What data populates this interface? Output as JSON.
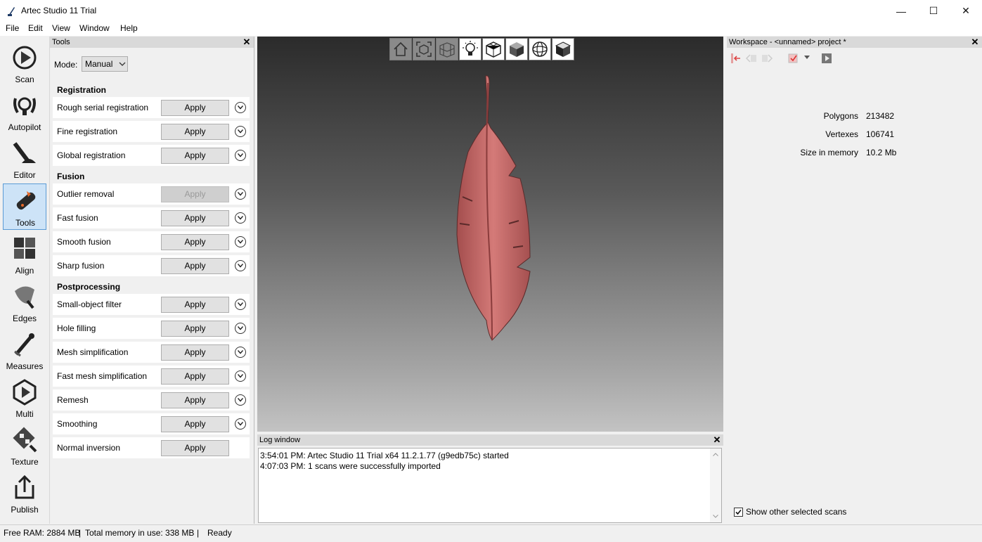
{
  "window": {
    "title": "Artec Studio 11 Trial"
  },
  "menu": [
    "File",
    "Edit",
    "View",
    "Window",
    "Help"
  ],
  "sidebar": [
    {
      "label": "Scan",
      "icon": "scan-icon"
    },
    {
      "label": "Autopilot",
      "icon": "autopilot-icon"
    },
    {
      "label": "Editor",
      "icon": "editor-icon"
    },
    {
      "label": "Tools",
      "icon": "tools-icon",
      "active": true
    },
    {
      "label": "Align",
      "icon": "align-icon"
    },
    {
      "label": "Edges",
      "icon": "edges-icon"
    },
    {
      "label": "Measures",
      "icon": "measures-icon"
    },
    {
      "label": "Multi",
      "icon": "multi-icon"
    },
    {
      "label": "Texture",
      "icon": "texture-icon"
    },
    {
      "label": "Publish",
      "icon": "publish-icon"
    }
  ],
  "tools": {
    "header": "Tools",
    "mode_label": "Mode:",
    "mode_value": "Manual",
    "apply_label": "Apply",
    "sections": [
      {
        "title": "Registration",
        "items": [
          "Rough serial registration",
          "Fine registration",
          "Global registration"
        ]
      },
      {
        "title": "Fusion",
        "items": [
          "Outlier removal",
          "Fast fusion",
          "Smooth fusion",
          "Sharp fusion"
        ]
      },
      {
        "title": "Postprocessing",
        "items": [
          "Small-object filter",
          "Hole filling",
          "Mesh simplification",
          "Fast mesh simplification",
          "Remesh",
          "Smoothing",
          "Normal inversion"
        ]
      }
    ]
  },
  "viewport": {
    "toolbar_icons": [
      "home-view-icon",
      "fit-view-icon",
      "grid-icon",
      "light-bulb-icon",
      "wireframe-cube-icon",
      "solid-cube-icon",
      "sphere-icon",
      "texture-cube-icon"
    ],
    "model_color": "#c86b6b"
  },
  "log": {
    "header": "Log window",
    "lines": [
      "3:54:01 PM: Artec Studio 11 Trial x64 11.2.1.77 (g9edb75c) started",
      "4:07:03 PM: 1 scans were successfully imported"
    ]
  },
  "workspace": {
    "header": "Workspace - <unnamed> project *",
    "stats": [
      {
        "label": "Polygons",
        "value": "213482"
      },
      {
        "label": "Vertexes",
        "value": "106741"
      },
      {
        "label": "Size in memory",
        "value": "10.2 Mb"
      }
    ],
    "show_other_label": "Show other selected scans",
    "show_other_checked": true
  },
  "status": {
    "free_ram": "Free RAM: 2884 MB",
    "total_memory": "Total memory in use: 338 MB",
    "state": "Ready"
  }
}
